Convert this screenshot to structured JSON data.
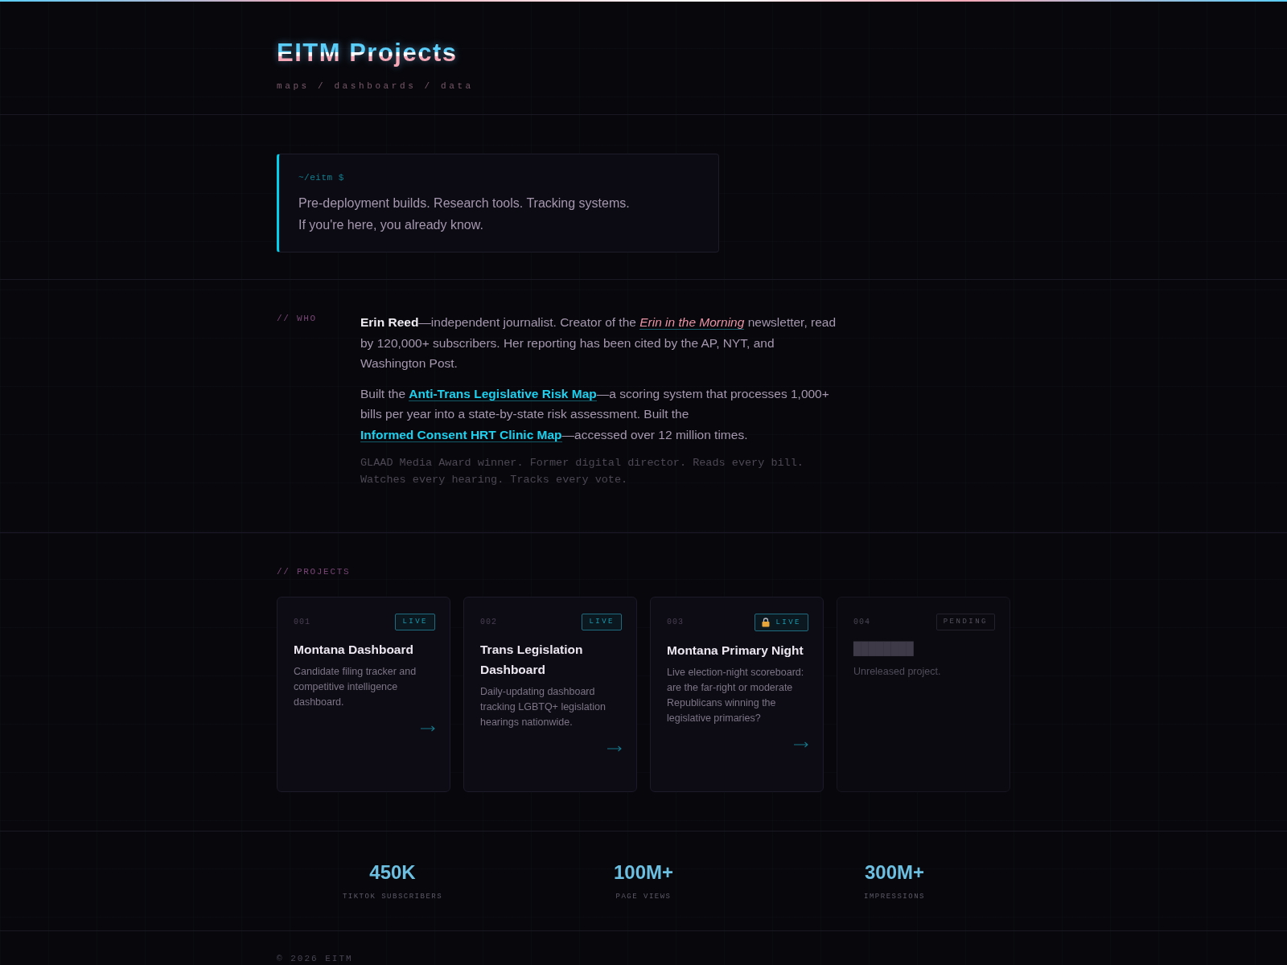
{
  "header": {
    "title": "EITM Projects",
    "tagline": "maps / dashboards / data"
  },
  "terminal": {
    "prompt": "~/eitm $",
    "lines": [
      "Pre-deployment builds. Research tools. Tracking systems.",
      "If you're here, you already know."
    ]
  },
  "who": {
    "label": "// WHO",
    "paragraphs": [
      {
        "parts": [
          {
            "kind": "text",
            "text": "**Erin Reed**—independent journalist. Creator of the "
          },
          {
            "kind": "emphasis",
            "text": "Erin in the Morning"
          },
          {
            "kind": "text",
            "text": " newsletter, read by 120,000+ subscribers. Her reporting has been cited by the AP, NYT, and Washington Post."
          }
        ]
      },
      {
        "parts": [
          {
            "kind": "text",
            "text": "Built the "
          },
          {
            "kind": "link",
            "text": "Anti-Trans Legislative Risk Map"
          },
          {
            "kind": "text",
            "text": "—a scoring system that processes 1,000+ bills per year into a state-by-state risk assessment. Built the "
          },
          {
            "kind": "link",
            "text": "Informed Consent HRT Clinic Map"
          },
          {
            "kind": "text",
            "text": "—accessed over 12 million times."
          }
        ]
      }
    ],
    "note": "GLAAD Media Award winner. Former digital director. Reads every bill. Watches every hearing. Tracks every vote."
  },
  "projects": {
    "label": "// PROJECTS",
    "cards": [
      {
        "number": "001",
        "badge": "LIVE",
        "kind": "live",
        "locked": false,
        "title": "Montana Dashboard",
        "description": "Candidate filing tracker and competitive intelligence dashboard."
      },
      {
        "number": "002",
        "badge": "LIVE",
        "kind": "live",
        "locked": false,
        "title": "Trans Legislation Dashboard",
        "description": "Daily-updating dashboard tracking LGBTQ+ legislation hearings nationwide."
      },
      {
        "number": "003",
        "badge": "LIVE",
        "kind": "live",
        "locked": true,
        "title": "Montana Primary Night",
        "description": "Live election-night scoreboard: are the far-right or moderate Republicans winning the legislative primaries?"
      },
      {
        "number": "004",
        "badge": "PENDING",
        "kind": "pending",
        "locked": false,
        "title": "████████",
        "description": "Unreleased project."
      }
    ]
  },
  "stats": [
    {
      "value": "450K",
      "label": "TIKTOK SUBSCRIBERS"
    },
    {
      "value": "100M+",
      "label": "PAGE VIEWS"
    },
    {
      "value": "300M+",
      "label": "IMPRESSIONS"
    }
  ],
  "footer": {
    "copyright": "© 2026 EITM"
  }
}
